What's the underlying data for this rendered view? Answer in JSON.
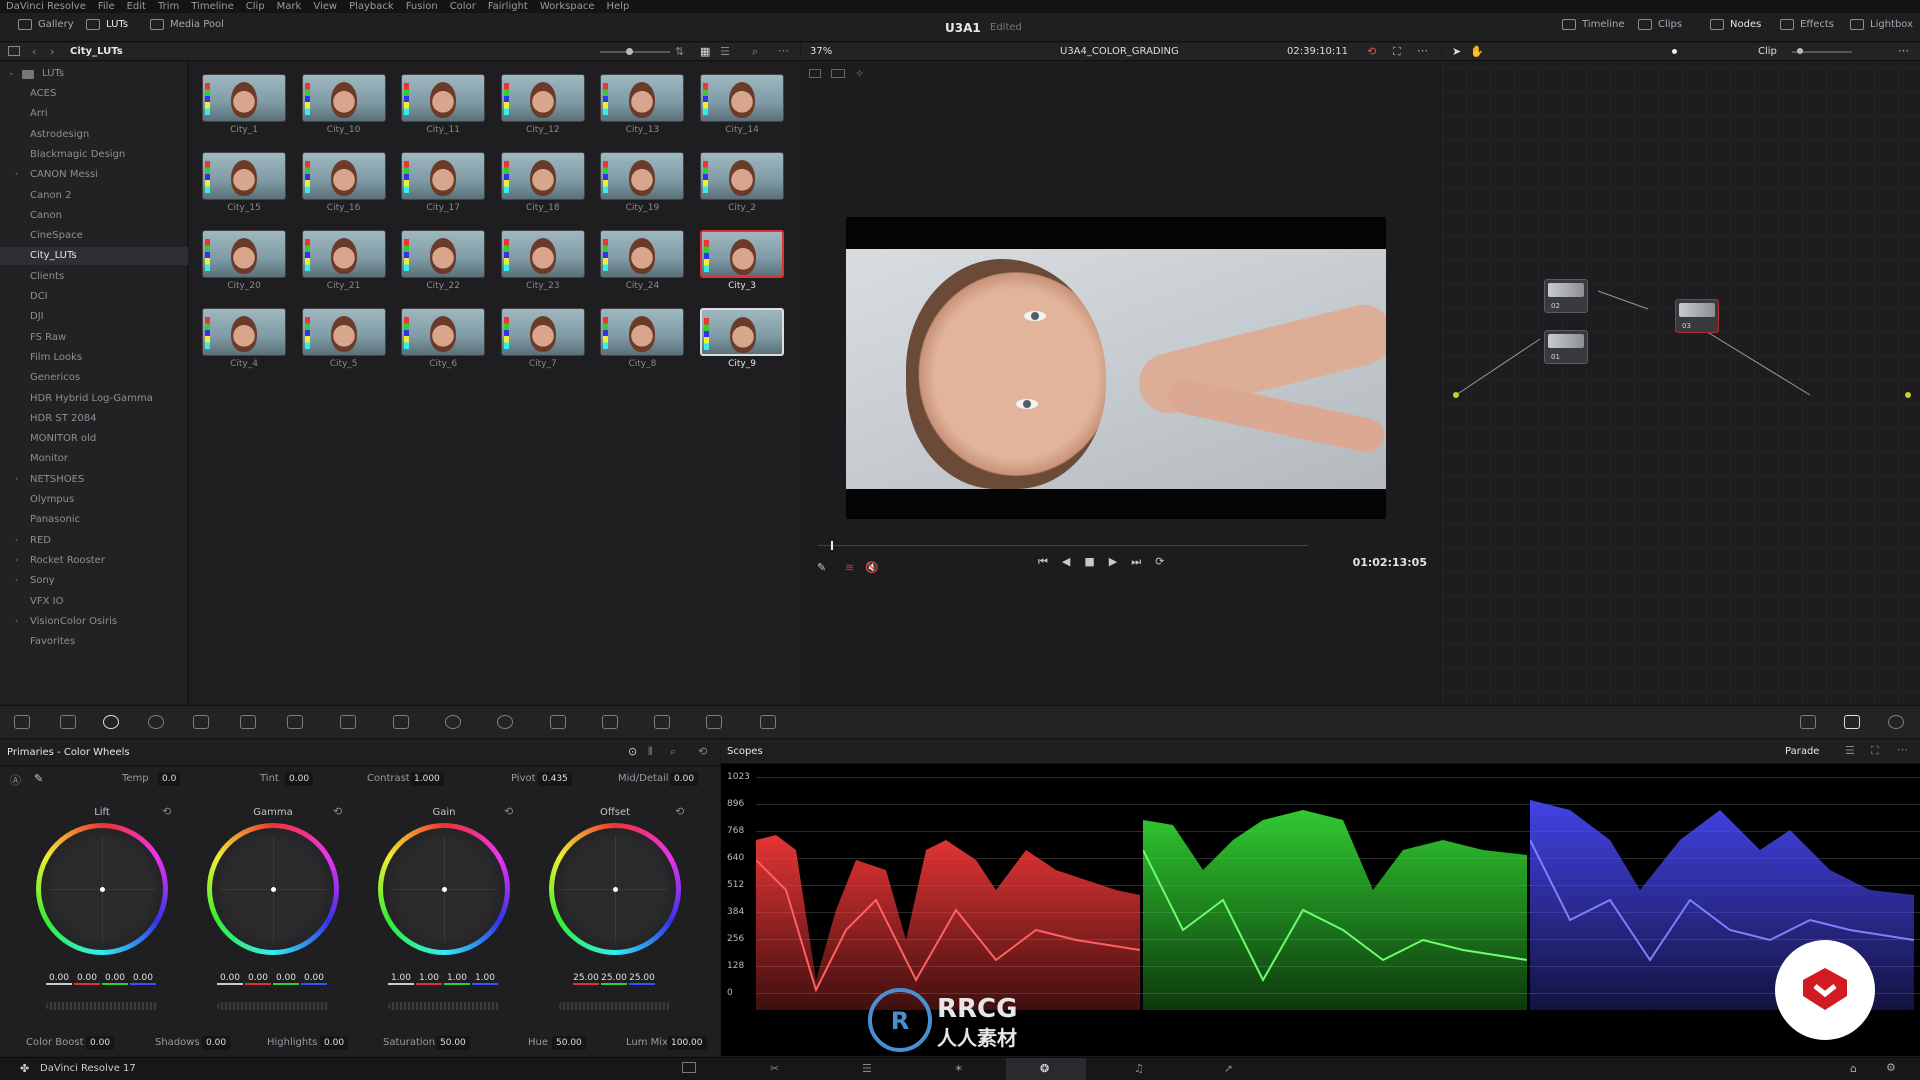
{
  "menu": [
    "DaVinci Resolve",
    "File",
    "Edit",
    "Trim",
    "Timeline",
    "Clip",
    "Mark",
    "View",
    "Playback",
    "Fusion",
    "Color",
    "Fairlight",
    "Workspace",
    "Help"
  ],
  "topbar": {
    "gallery": "Gallery",
    "luts": "LUTs",
    "media_pool": "Media Pool",
    "project": "U3A1",
    "status": "Edited",
    "timeline": "Timeline",
    "clips": "Clips",
    "nodes": "Nodes",
    "effects": "Effects",
    "lightbox": "Lightbox"
  },
  "browser": {
    "folder": "City_LUTs",
    "root": "LUTs",
    "folders": [
      "ACES",
      "Arri",
      "Astrodesign",
      "Blackmagic Design",
      "CANON Messi",
      "Canon 2",
      "Canon",
      "CineSpace",
      "City_LUTs",
      "Clients",
      "DCI",
      "DJI",
      "FS Raw",
      "Film Looks",
      "Genericos",
      "HDR Hybrid Log-Gamma",
      "HDR ST 2084",
      "MONITOR old",
      "Monitor",
      "NETSHOES",
      "Olympus",
      "Panasonic",
      "RED",
      "Rocket Rooster",
      "Sony",
      "VFX IO",
      "VisionColor Osiris",
      "Favorites"
    ],
    "thumbs": [
      "City_1",
      "City_10",
      "City_11",
      "City_12",
      "City_13",
      "City_14",
      "City_15",
      "City_16",
      "City_17",
      "City_18",
      "City_19",
      "City_2",
      "City_20",
      "City_21",
      "City_22",
      "City_23",
      "City_24",
      "City_3",
      "City_4",
      "City_5",
      "City_6",
      "City_7",
      "City_8",
      "City_9"
    ]
  },
  "viewer": {
    "zoom": "37%",
    "timeline": "U3A4_COLOR_GRADING",
    "timecode_top": "02:39:10:11",
    "timecode": "01:02:13:05"
  },
  "nodes": {
    "mode": "Clip",
    "labels": [
      "02",
      "01",
      "03"
    ]
  },
  "primaries": {
    "title": "Primaries - Color Wheels",
    "temp_label": "Temp",
    "temp": "0.0",
    "tint_label": "Tint",
    "tint": "0.00",
    "contrast_label": "Contrast",
    "contrast": "1.000",
    "pivot_label": "Pivot",
    "pivot": "0.435",
    "middetail_label": "Mid/Detail",
    "middetail": "0.00",
    "wheels": [
      {
        "name": "Lift",
        "vals": [
          "0.00",
          "0.00",
          "0.00",
          "0.00"
        ]
      },
      {
        "name": "Gamma",
        "vals": [
          "0.00",
          "0.00",
          "0.00",
          "0.00"
        ]
      },
      {
        "name": "Gain",
        "vals": [
          "1.00",
          "1.00",
          "1.00",
          "1.00"
        ]
      },
      {
        "name": "Offset",
        "vals": [
          "25.00",
          "25.00",
          "25.00"
        ]
      }
    ],
    "colorboost_label": "Color Boost",
    "colorboost": "0.00",
    "shadows_label": "Shadows",
    "shadows": "0.00",
    "highlights_label": "Highlights",
    "highlights": "0.00",
    "saturation_label": "Saturation",
    "saturation": "50.00",
    "hue_label": "Hue",
    "hue": "50.00",
    "lummix_label": "Lum Mix",
    "lummix": "100.00"
  },
  "scopes": {
    "title": "Scopes",
    "mode": "Parade",
    "ylabels": [
      "1023",
      "896",
      "768",
      "640",
      "512",
      "384",
      "256",
      "128",
      "0"
    ],
    "colors": {
      "red": "#ff3b3b",
      "green": "#35e035",
      "blue": "#4a4aff"
    }
  },
  "footer": {
    "app": "DaVinci Resolve 17"
  },
  "watermark": {
    "text": "RRCG",
    "sub": "人人素材"
  }
}
